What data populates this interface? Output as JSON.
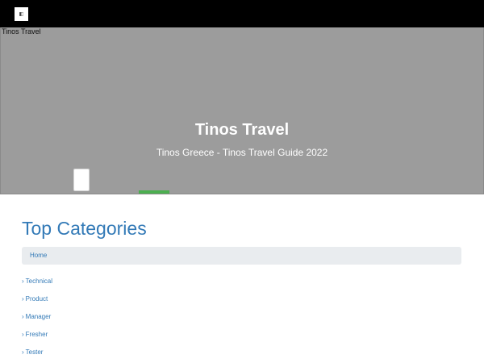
{
  "header": {
    "logo_icon": "logo-icon"
  },
  "hero": {
    "image_alt": "Tinos Travel",
    "title": "Tinos Travel",
    "subtitle": "Tinos Greece - Tinos Travel Guide 2022",
    "accent_color": "#4caf50"
  },
  "main": {
    "section_title": "Top Categories",
    "breadcrumb": {
      "home_label": "Home"
    },
    "categories": [
      {
        "label": "Technical"
      },
      {
        "label": "Product"
      },
      {
        "label": "Manager"
      },
      {
        "label": "Fresher"
      },
      {
        "label": "Tester"
      }
    ],
    "chevron": "›",
    "link_color": "#337ab7"
  }
}
